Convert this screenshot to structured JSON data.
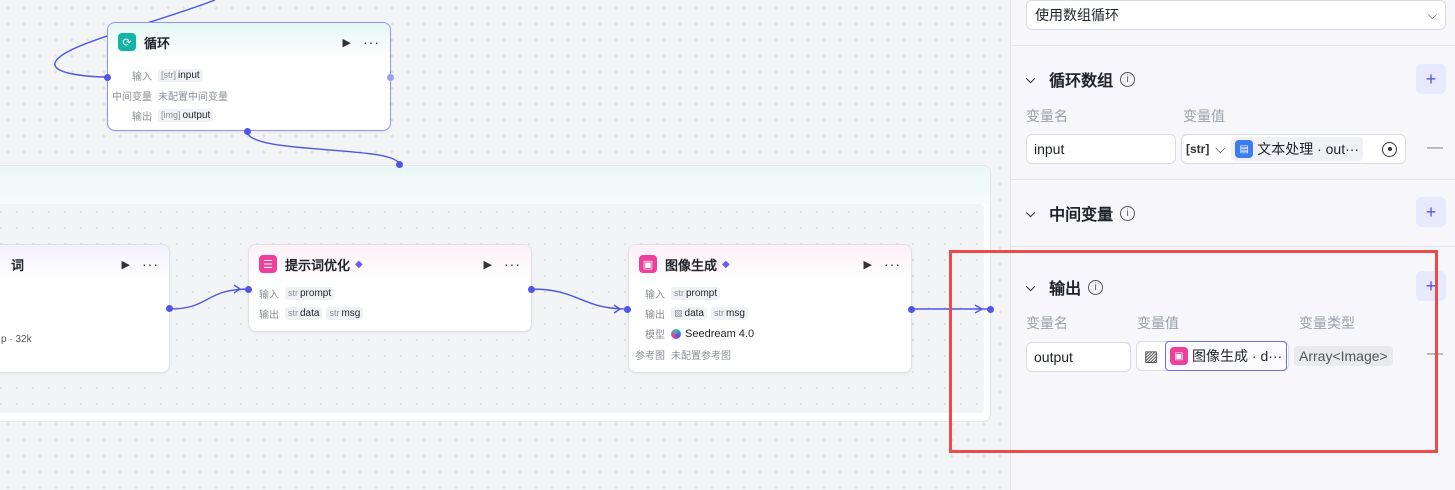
{
  "canvas": {
    "loop_node": {
      "title": "循环",
      "rows": [
        {
          "label": "输入",
          "chip_type": "[str]",
          "chip": "input"
        },
        {
          "label": "中间变量",
          "text": "未配置中间变量"
        },
        {
          "label": "输出",
          "chip_type": "[img]",
          "chip": "output"
        }
      ],
      "icon": "loop-icon",
      "icon_color": "#12b5a8"
    },
    "partial_node": {
      "title": "词",
      "meta": "p · 32k"
    },
    "prompt_node": {
      "title": "提示词优化",
      "icon": "list-icon",
      "icon_color": "#ee3f9b",
      "rows": [
        {
          "label": "输入",
          "chips": [
            {
              "type": "str",
              "name": "prompt"
            }
          ]
        },
        {
          "label": "输出",
          "chips": [
            {
              "type": "str",
              "name": "data"
            },
            {
              "type": "str",
              "name": "msg"
            }
          ]
        }
      ]
    },
    "image_node": {
      "title": "图像生成",
      "icon": "image-icon",
      "icon_color": "#ee3f9b",
      "rows": [
        {
          "label": "输入",
          "chips": [
            {
              "type": "str",
              "name": "prompt"
            }
          ]
        },
        {
          "label": "输出",
          "chips": [
            {
              "type": "img",
              "name": "data"
            },
            {
              "type": "str",
              "name": "msg"
            }
          ]
        },
        {
          "label": "模型",
          "model": "Seedream 4.0"
        },
        {
          "label": "参考图",
          "text": "未配置参考图"
        }
      ]
    }
  },
  "panel": {
    "loop_type_select": "使用数组循环",
    "loop_array": {
      "title": "循环数组",
      "col_name": "变量名",
      "col_value": "变量值",
      "var_name": "input",
      "type_prefix": "[str]",
      "ref_text": "文本处理 · out···"
    },
    "middle_vars": {
      "title": "中间变量"
    },
    "output": {
      "title": "输出",
      "col_name": "变量名",
      "col_value": "变量值",
      "col_type": "变量类型",
      "var_name": "output",
      "ref_text": "图像生成 · d···",
      "type": "Array<Image>"
    }
  },
  "colors": {
    "accent": "#4f55e6",
    "highlight": "#ef4a4a"
  }
}
